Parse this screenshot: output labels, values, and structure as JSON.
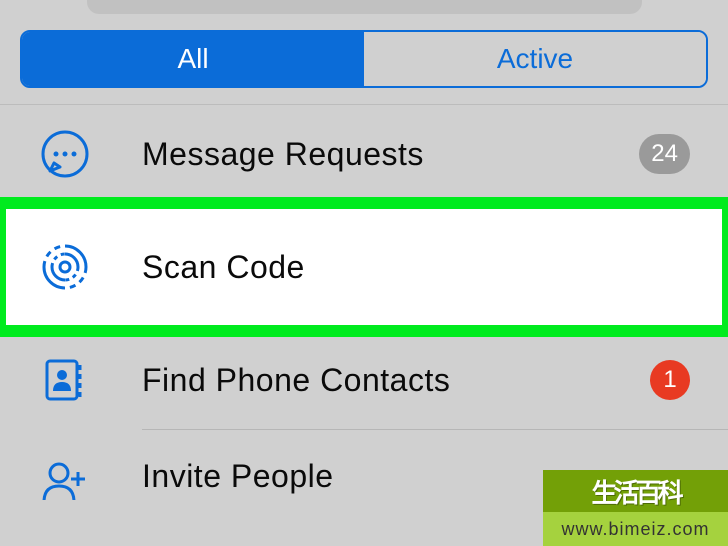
{
  "segmented": {
    "all": "All",
    "active": "Active"
  },
  "rows": {
    "message_requests": {
      "label": "Message Requests",
      "badge": "24"
    },
    "scan_code": {
      "label": "Scan Code"
    },
    "find_contacts": {
      "label": "Find Phone Contacts",
      "badge": "1"
    },
    "invite": {
      "label": "Invite People"
    }
  },
  "watermark": {
    "top": "生活百科",
    "bottom": "www.bimeiz.com"
  }
}
